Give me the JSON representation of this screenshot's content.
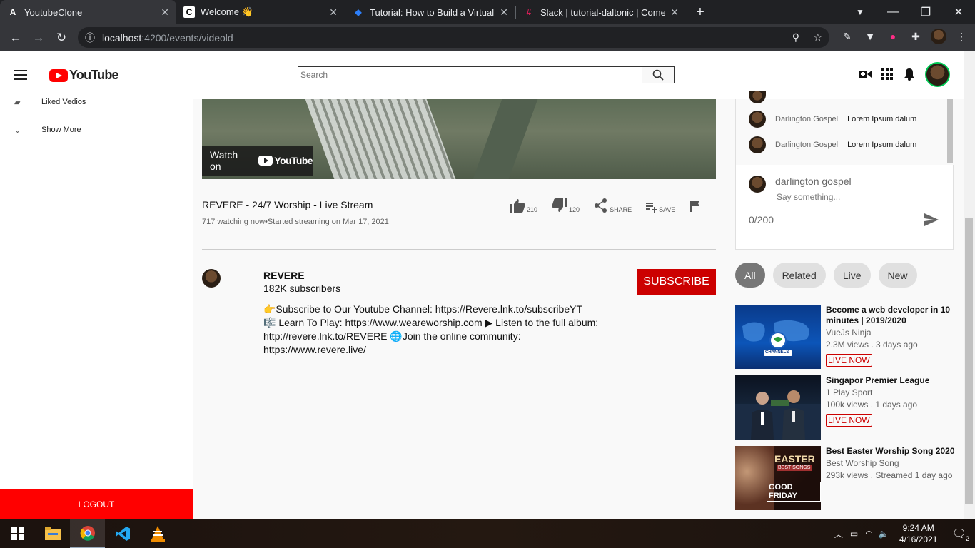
{
  "browser": {
    "tabs": [
      {
        "title": "YoutubeClone",
        "favicon": "A"
      },
      {
        "title": "Welcome 👋",
        "favicon": "C"
      },
      {
        "title": "Tutorial: How to Build a Virtual E",
        "favicon": "◆"
      },
      {
        "title": "Slack | tutorial-daltonic | CometC",
        "favicon": "#"
      }
    ],
    "url_host": "localhost",
    "url_path": ":4200/events/videold"
  },
  "header": {
    "logo_text": "YouTube",
    "search_placeholder": "Search"
  },
  "sidebar": {
    "items": [
      {
        "label": "Liked Vedios",
        "icon": "thumb-up-icon"
      },
      {
        "label": "Show More",
        "icon": "chevron-down-icon"
      }
    ],
    "logout_label": "LOGOUT"
  },
  "video": {
    "watch_on_label": "Watch on",
    "watch_on_brand": "YouTube",
    "title": "REVERE - 24/7 Worship - Live Stream",
    "meta": "717 watching now•Started streaming on Mar 17, 2021",
    "likes": "210",
    "dislikes": "120",
    "share_label": "SHARE",
    "save_label": "SAVE"
  },
  "channel": {
    "name": "REVERE",
    "subscribers": "182K subscribers",
    "subscribe_label": "SUBSCRIBE",
    "description_1": "👉Subscribe to Our Youtube Channel: https://Revere.lnk.to/subscribeYT",
    "description_2": "🎼 Learn To Play: https://www.weareworship.com ▶ Listen to the full album: http://revere.lnk.to/REVERE 🌐Join the online community: https://www.revere.live/"
  },
  "chat": {
    "messages": [
      {
        "author": "Darlington Gospel",
        "text": "Lorem Ipsum dalum"
      },
      {
        "author": "Darlington Gospel",
        "text": "Lorem Ipsum dalum"
      }
    ],
    "compose_name": "darlington gospel",
    "compose_placeholder": "Say something...",
    "counter": "0/200"
  },
  "filters": {
    "chips": [
      "All",
      "Related",
      "Live",
      "New"
    ],
    "active": "All"
  },
  "recommendations": [
    {
      "title": "Become a web developer in 10 minutes | 2019/2020",
      "channel": "VueJs Ninja",
      "stats": "2.3M views . 3 days ago",
      "badge": "LIVE NOW"
    },
    {
      "title": "Singapor Premier League",
      "channel": "1 Play Sport",
      "stats": "100k views . 1 days ago",
      "badge": "LIVE NOW"
    },
    {
      "title": "Best Easter Worship Song 2020",
      "channel": "Best Worship Song",
      "stats": "293k views . Streamed 1 day ago",
      "badge": ""
    }
  ],
  "thumb_text": {
    "channels": "CHANNELS",
    "easter": "EASTER",
    "best_songs": "BEST SONGS",
    "good_friday": "GOOD FRIDAY"
  },
  "taskbar": {
    "time": "9:24 AM",
    "date": "4/16/2021",
    "notifications": "2"
  },
  "colors": {
    "brand_red": "#ff0000",
    "subscribe_red": "#cc0000",
    "chip_active": "#777777"
  }
}
